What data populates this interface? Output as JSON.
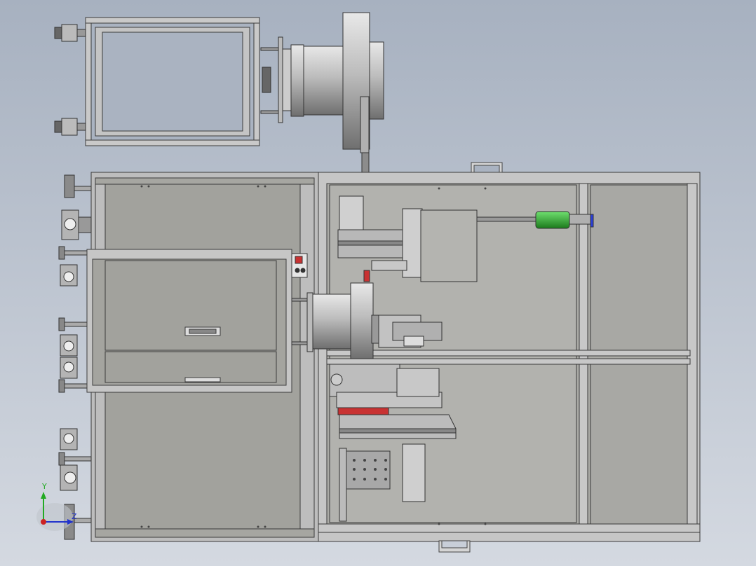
{
  "scene": {
    "background_top": "#a9b3c1",
    "background_bottom": "#d2d8e0",
    "frame_stroke": "#3c3c3c",
    "panel_fill": "#a3a39e",
    "metal_fill": "#c8c8c8",
    "dark_metal": "#7f7f7f",
    "red_part": "#c83232",
    "green_part": "#2fa82f",
    "blue_part": "#2b3fd8"
  },
  "triad": {
    "y_label": "Y",
    "z_label": "Z",
    "y_color": "#22aa22",
    "z_color": "#2233cc",
    "x_color": "#cc2222"
  }
}
